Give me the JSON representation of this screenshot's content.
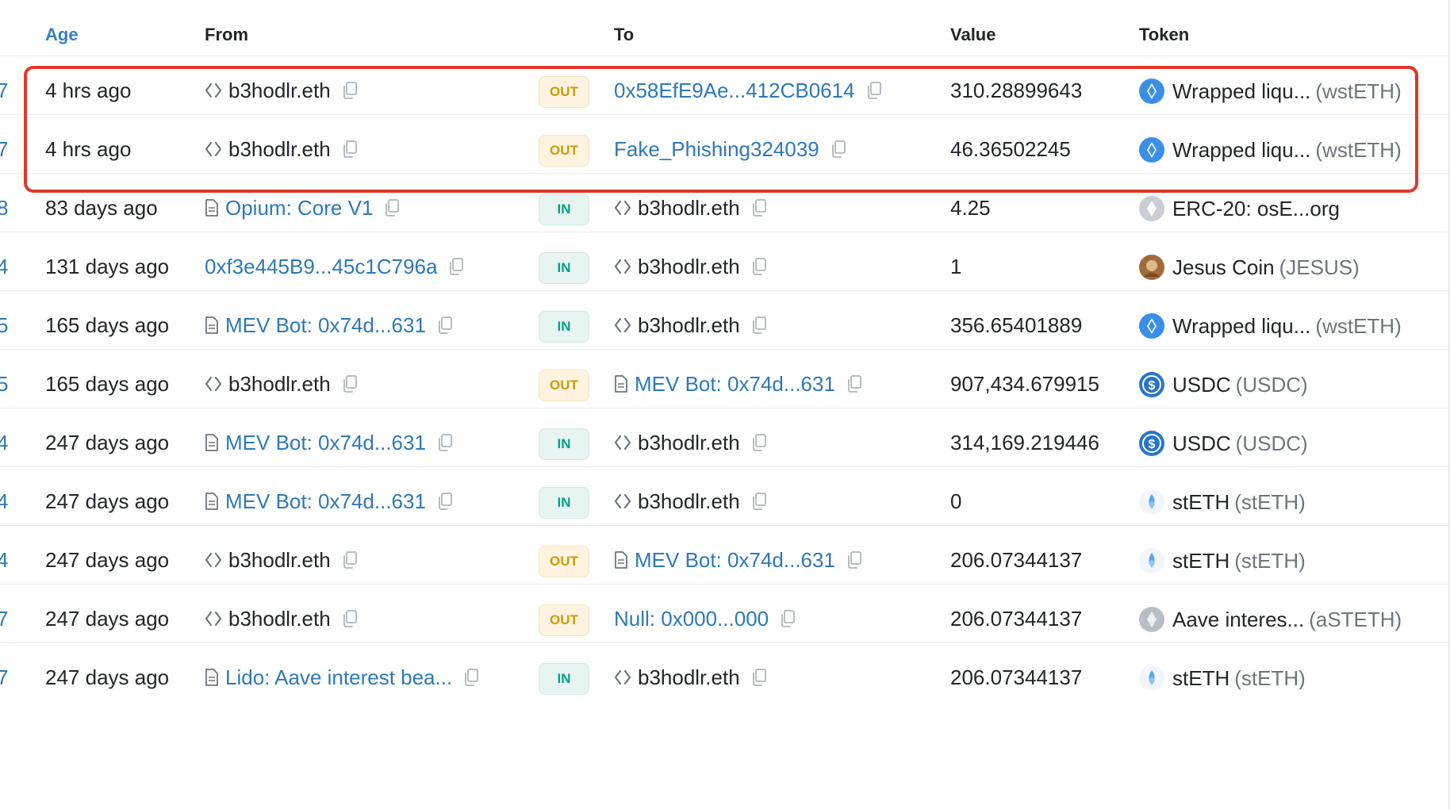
{
  "headers": {
    "age": "Age",
    "from": "From",
    "to": "To",
    "value": "Value",
    "token": "Token"
  },
  "colors": {
    "link": "#2e78b7",
    "out_badge_bg": "#fdf3e0",
    "out_badge_text": "#cc9a06",
    "in_badge_bg": "#e8f4f1",
    "in_badge_text": "#00a186",
    "highlight": "#e0372b"
  },
  "rows": [
    {
      "block": "7",
      "age": "4 hrs ago",
      "from": "b3hodlr.eth",
      "from_type": "contract",
      "from_link": false,
      "direction": "OUT",
      "to": "0x58EfE9Ae...412CB0614",
      "to_type": "none",
      "to_link": true,
      "value": "310.28899643",
      "token_name": "Wrapped liqu...",
      "token_symbol": "(wstETH)",
      "token_icon": "wsteth-icon"
    },
    {
      "block": "7",
      "age": "4 hrs ago",
      "from": "b3hodlr.eth",
      "from_type": "contract",
      "from_link": false,
      "direction": "OUT",
      "to": "Fake_Phishing324039",
      "to_type": "none",
      "to_link": true,
      "value": "46.36502245",
      "token_name": "Wrapped liqu...",
      "token_symbol": "(wstETH)",
      "token_icon": "wsteth-icon"
    },
    {
      "block": "8",
      "age": "83 days ago",
      "from": "Opium: Core V1",
      "from_type": "doc",
      "from_link": true,
      "direction": "IN",
      "to": "b3hodlr.eth",
      "to_type": "contract",
      "to_link": false,
      "value": "4.25",
      "token_name": "ERC-20: osE...org",
      "token_symbol": "",
      "token_icon": "erc20-icon"
    },
    {
      "block": "4",
      "age": "131 days ago",
      "from": "0xf3e445B9...45c1C796a",
      "from_type": "none",
      "from_link": true,
      "direction": "IN",
      "to": "b3hodlr.eth",
      "to_type": "contract",
      "to_link": false,
      "value": "1",
      "token_name": "Jesus Coin",
      "token_symbol": "(JESUS)",
      "token_icon": "jesus-coin-icon"
    },
    {
      "block": "5",
      "age": "165 days ago",
      "from": "MEV Bot: 0x74d...631",
      "from_type": "doc",
      "from_link": true,
      "direction": "IN",
      "to": "b3hodlr.eth",
      "to_type": "contract",
      "to_link": false,
      "value": "356.65401889",
      "token_name": "Wrapped liqu...",
      "token_symbol": "(wstETH)",
      "token_icon": "wsteth-icon"
    },
    {
      "block": "5",
      "age": "165 days ago",
      "from": "b3hodlr.eth",
      "from_type": "contract",
      "from_link": false,
      "direction": "OUT",
      "to": "MEV Bot: 0x74d...631",
      "to_type": "doc",
      "to_link": true,
      "value": "907,434.679915",
      "token_name": "USDC",
      "token_symbol": "(USDC)",
      "token_icon": "usdc-icon"
    },
    {
      "block": "4",
      "age": "247 days ago",
      "from": "MEV Bot: 0x74d...631",
      "from_type": "doc",
      "from_link": true,
      "direction": "IN",
      "to": "b3hodlr.eth",
      "to_type": "contract",
      "to_link": false,
      "value": "314,169.219446",
      "token_name": "USDC",
      "token_symbol": "(USDC)",
      "token_icon": "usdc-icon"
    },
    {
      "block": "4",
      "age": "247 days ago",
      "from": "MEV Bot: 0x74d...631",
      "from_type": "doc",
      "from_link": true,
      "direction": "IN",
      "to": "b3hodlr.eth",
      "to_type": "contract",
      "to_link": false,
      "value": "0",
      "token_name": "stETH",
      "token_symbol": "(stETH)",
      "token_icon": "steth-icon"
    },
    {
      "block": "4",
      "age": "247 days ago",
      "from": "b3hodlr.eth",
      "from_type": "contract",
      "from_link": false,
      "direction": "OUT",
      "to": "MEV Bot: 0x74d...631",
      "to_type": "doc",
      "to_link": true,
      "value": "206.07344137",
      "token_name": "stETH",
      "token_symbol": "(stETH)",
      "token_icon": "steth-icon"
    },
    {
      "block": "7",
      "age": "247 days ago",
      "from": "b3hodlr.eth",
      "from_type": "contract",
      "from_link": false,
      "direction": "OUT",
      "to": "Null: 0x000...000",
      "to_type": "none",
      "to_link": true,
      "value": "206.07344137",
      "token_name": "Aave interes...",
      "token_symbol": "(aSTETH)",
      "token_icon": "aave-icon"
    },
    {
      "block": "7",
      "age": "247 days ago",
      "from": "Lido: Aave interest bea...",
      "from_type": "doc",
      "from_link": true,
      "direction": "IN",
      "to": "b3hodlr.eth",
      "to_type": "contract",
      "to_link": false,
      "value": "206.07344137",
      "token_name": "stETH",
      "token_symbol": "(stETH)",
      "token_icon": "steth-icon"
    }
  ]
}
